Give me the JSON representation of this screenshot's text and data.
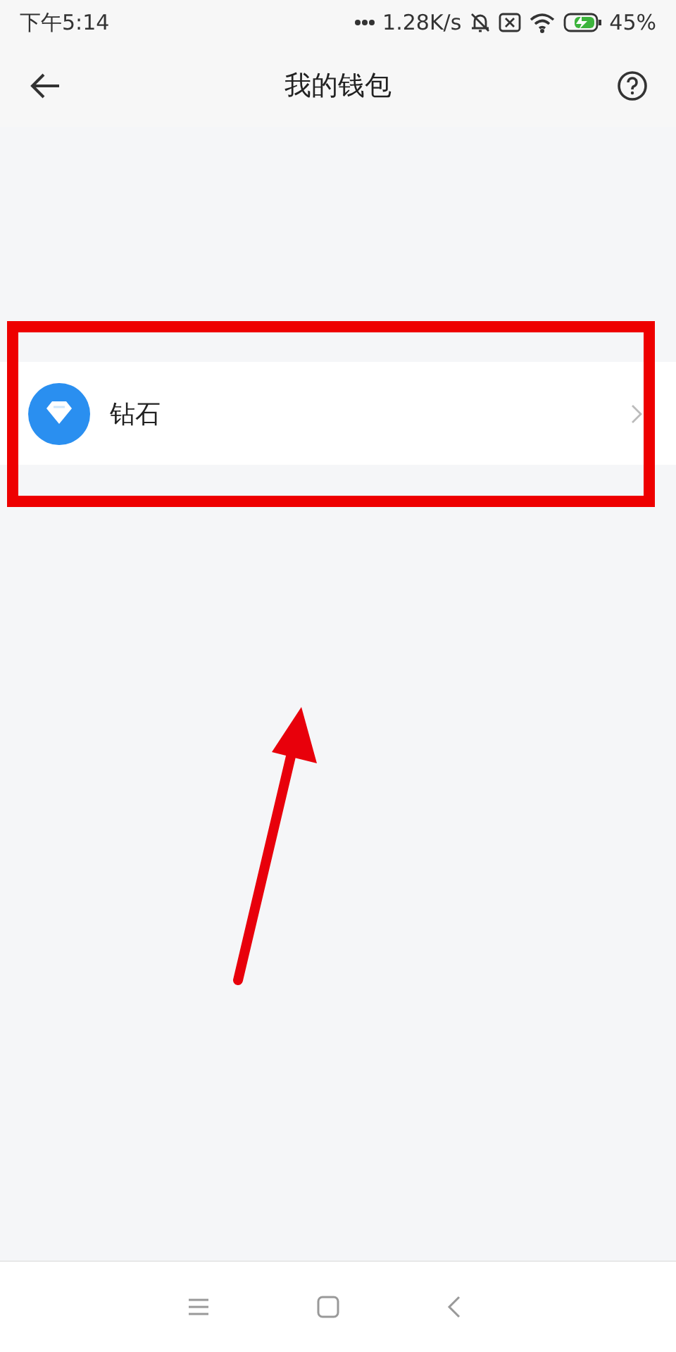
{
  "status_bar": {
    "time": "下午5:14",
    "speed": "1.28K/s",
    "battery": "45%"
  },
  "header": {
    "title": "我的钱包"
  },
  "items": [
    {
      "label": "钻石"
    }
  ]
}
